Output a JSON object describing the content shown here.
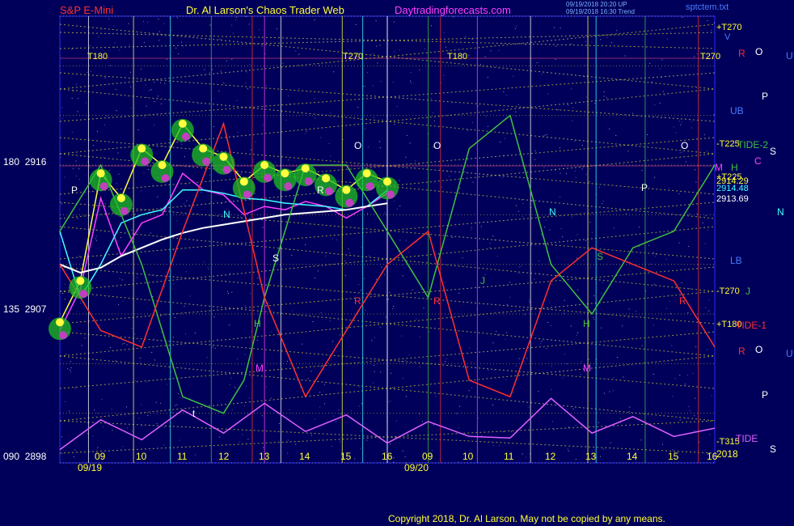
{
  "header": {
    "instrument": "S&P E-Mini",
    "author": "Dr. Al Larson's Chaos Trader Web",
    "site": "Daytradingforecasts.com",
    "stamp1": "09/19/2018 20:20 UP",
    "stamp2": "09/19/2018 16:30 Trend",
    "file": "sptctem.txt"
  },
  "footer": {
    "copyright": "Copyright 2018, Dr. Al Larson. May not be copied by any means."
  },
  "axis": {
    "y_labels": [
      {
        "angle": "180",
        "price": "2916"
      },
      {
        "angle": "135",
        "price": "2907"
      },
      {
        "angle": "090",
        "price": "2898"
      }
    ],
    "x_labels": [
      "09",
      "10",
      "11",
      "12",
      "13",
      "14",
      "15",
      "16",
      "09",
      "10",
      "11",
      "12",
      "13",
      "14",
      "15",
      "16"
    ],
    "dates": [
      "09/19",
      "09/20"
    ],
    "year": "2018"
  },
  "annotations": {
    "top_T": [
      "T180",
      "T270",
      "T180",
      "T270"
    ],
    "right_T": [
      "+T270",
      "-T225",
      "+T225",
      "-T270",
      "+T180",
      "-T315"
    ],
    "prices": [
      "2914.29",
      "2914.48",
      "2913.69"
    ],
    "planets": [
      "V",
      "R",
      "O",
      "U",
      "P",
      "UB",
      "S",
      "C",
      "M",
      "H",
      "N",
      "LB",
      "J",
      "R",
      "O",
      "U",
      "P",
      "S"
    ],
    "tides": [
      "TIDE-2",
      "TIDE-1",
      "TIDE"
    ],
    "chart_letters": [
      "P",
      "N",
      "S",
      "R",
      "H",
      "M",
      "O",
      "R",
      "O",
      "R",
      "N",
      "S",
      "H",
      "M",
      "O",
      "P",
      "R",
      "J",
      "t"
    ]
  },
  "chart_data": {
    "type": "line",
    "title": "S&P E-Mini",
    "xlabel": "",
    "ylabel": "",
    "ylim": [
      2898,
      2925
    ],
    "x_range": [
      "09/19 08:00",
      "09/20 16:00"
    ],
    "series": [
      {
        "color": "#ffff40",
        "x": [
          0,
          0.5,
          1,
          1.5,
          2,
          2.5,
          3,
          3.5,
          4,
          4.5,
          5,
          5.5,
          6,
          6.5,
          7,
          7.5,
          8
        ],
        "values": [
          2906.5,
          2909.0,
          2915.5,
          2914.0,
          2917.0,
          2916.0,
          2918.5,
          2917.0,
          2916.5,
          2915.0,
          2916.0,
          2915.5,
          2915.8,
          2915.2,
          2914.5,
          2915.5,
          2915.0
        ]
      },
      {
        "color": "#ff40ff",
        "x": [
          0,
          0.5,
          1,
          1.5,
          2,
          2.5,
          3,
          3.5,
          4,
          4.5,
          5,
          5.5,
          6,
          6.5,
          7,
          7.5,
          8
        ],
        "values": [
          2906.0,
          2908.5,
          2914.0,
          2910.5,
          2912.5,
          2913.0,
          2915.5,
          2914.5,
          2914.2,
          2913.0,
          2913.5,
          2913.3,
          2913.8,
          2913.5,
          2912.8,
          2913.5,
          2914.3
        ]
      },
      {
        "color": "#40ffff",
        "x": [
          0,
          0.5,
          1,
          1.5,
          2,
          2.5,
          3,
          3.5,
          4,
          4.5,
          5,
          5.5,
          6,
          6.5,
          7,
          7.5,
          8
        ],
        "values": [
          2912.0,
          2908.0,
          2910.0,
          2912.5,
          2913.0,
          2913.3,
          2914.5,
          2914.5,
          2914.3,
          2914.0,
          2913.9,
          2913.7,
          2913.6,
          2913.5,
          2913.3,
          2913.5,
          2914.48
        ]
      },
      {
        "color": "#ffffff",
        "x": [
          0,
          0.5,
          1,
          1.5,
          2,
          2.5,
          3,
          3.5,
          4,
          4.5,
          5,
          5.5,
          6,
          6.5,
          7,
          7.5,
          8
        ],
        "values": [
          2910.0,
          2909.5,
          2909.8,
          2910.5,
          2911.0,
          2911.5,
          2911.9,
          2912.2,
          2912.4,
          2912.6,
          2912.8,
          2913.0,
          2913.1,
          2913.2,
          2913.3,
          2913.5,
          2913.69
        ]
      },
      {
        "color": "#40c040",
        "x": [
          0,
          1,
          2,
          3,
          4,
          4.5,
          5,
          6,
          7,
          8,
          9,
          10,
          11,
          12,
          13,
          14,
          15,
          16
        ],
        "values": [
          2912.0,
          2916.0,
          2910.0,
          2902.0,
          2901.0,
          2903.0,
          2908.0,
          2916.0,
          2916.0,
          2912.0,
          2908.0,
          2917.0,
          2919.0,
          2910.0,
          2907.0,
          2911.0,
          2912.0,
          2916.0
        ]
      },
      {
        "color": "#ff3030",
        "x": [
          0,
          1,
          2,
          3,
          4,
          5,
          6,
          7,
          8,
          9,
          10,
          11,
          12,
          13,
          14,
          15,
          16
        ],
        "values": [
          2910.0,
          2906.0,
          2905.0,
          2912.0,
          2918.5,
          2908.0,
          2902.0,
          2906.0,
          2910.0,
          2912.0,
          2903.0,
          2902.0,
          2909.0,
          2911.0,
          2910.0,
          2909.0,
          2905.0
        ]
      },
      {
        "color": "#e060ff",
        "x": [
          0,
          1,
          2,
          3,
          4,
          5,
          6,
          7,
          8,
          9,
          10,
          11,
          12,
          13,
          14,
          15,
          16
        ],
        "values": [
          2898.8,
          2900.6,
          2899.4,
          2901.2,
          2899.8,
          2901.6,
          2899.9,
          2900.9,
          2899.2,
          2900.5,
          2899.6,
          2899.5,
          2901.9,
          2899.8,
          2900.8,
          2899.6,
          2900.1
        ]
      }
    ]
  }
}
